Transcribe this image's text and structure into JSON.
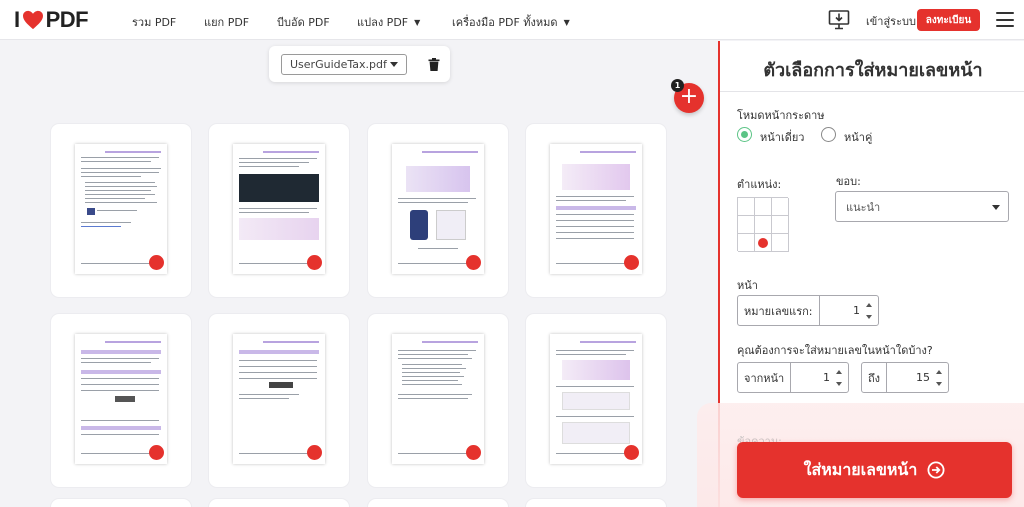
{
  "header": {
    "logo_left": "I",
    "logo_right": "PDF",
    "nav": [
      {
        "label": "รวม PDF",
        "dropdown": false
      },
      {
        "label": "แยก PDF",
        "dropdown": false
      },
      {
        "label": "บีบอัด PDF",
        "dropdown": false
      },
      {
        "label": "แปลง PDF",
        "dropdown": true
      },
      {
        "label": "เครื่องมือ PDF ทั้งหมด",
        "dropdown": true
      }
    ],
    "login": "เข้าสู่ระบบ",
    "signup": "ลงทะเบียน"
  },
  "filebar": {
    "file_name": "UserGuideTax.pdf"
  },
  "add_button": {
    "badge": "1",
    "label": "+"
  },
  "panel": {
    "title": "ตัวเลือกการใส่หมายเลขหน้า",
    "page_mode_label": "โหมดหน้ากระดาษ",
    "mode_single": "หน้าเดี่ยว",
    "mode_facing": "หน้าคู่",
    "mode_selected": "single",
    "position_label": "ตำแหน่ง:",
    "margin_label": "ขอบ:",
    "margin_value": "แนะนำ",
    "pages_label": "หน้า",
    "first_number_label": "หมายเลขแรก:",
    "first_number_value": "1",
    "range_question": "คุณต้องการจะใส่หมายเลขในหน้าใดบ้าง?",
    "from_label": "จากหน้า",
    "from_value": "1",
    "to_label": "ถึง",
    "to_value": "15",
    "message_label": "ข้อความ:",
    "cta": "ใส่หมายเลขหน้า"
  },
  "colors": {
    "brand": "#e5322d",
    "radio_active": "#5cc486"
  }
}
